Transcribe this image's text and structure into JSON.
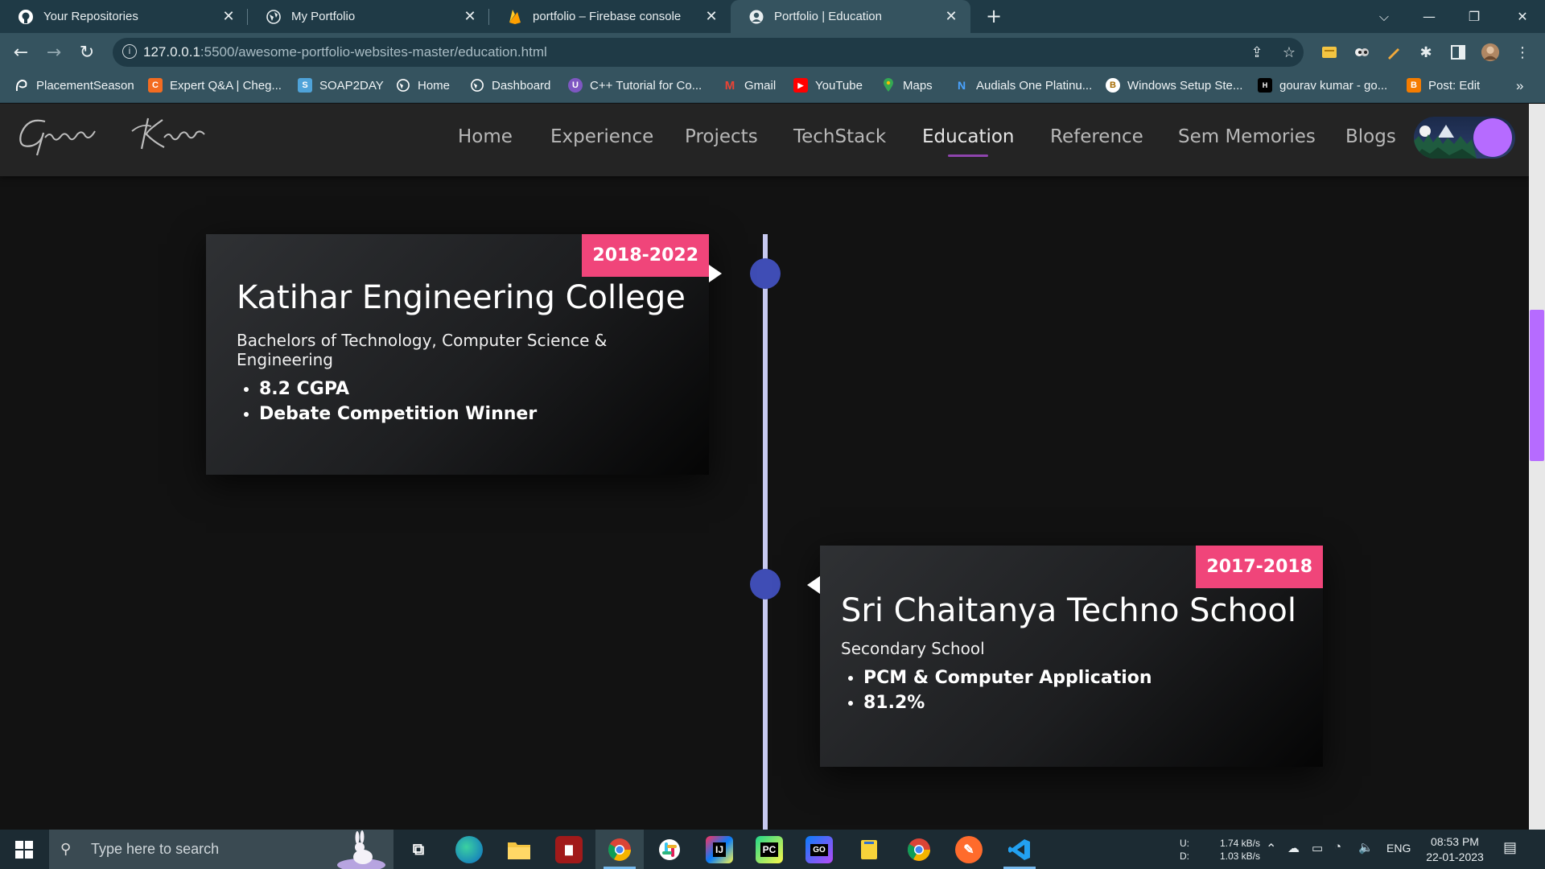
{
  "browser": {
    "tabs": [
      {
        "label": "Your Repositories",
        "icon": "github-icon"
      },
      {
        "label": "My Portfolio",
        "icon": "globe-icon"
      },
      {
        "label": "portfolio – Firebase console",
        "icon": "firebase-icon"
      },
      {
        "label": "Portfolio | Education",
        "icon": "avatar-icon",
        "active": true
      }
    ],
    "url_host": "127.0.0.1",
    "url_path": ":5500/awesome-portfolio-websites-master/education.html",
    "bookmarks": [
      {
        "label": "PlacementSeason",
        "icon": "placementseason-icon",
        "color": "#2e7d32"
      },
      {
        "label": "Expert Q&A | Cheg...",
        "icon": "chegg-icon",
        "color": "#f36c21",
        "glyph": "C"
      },
      {
        "label": "SOAP2DAY",
        "icon": "soap2day-icon",
        "color": "#4fa3d9",
        "glyph": "S"
      },
      {
        "label": "Home",
        "icon": "globe-icon",
        "color": "#607d8b"
      },
      {
        "label": "Dashboard",
        "icon": "globe-icon",
        "color": "#607d8b"
      },
      {
        "label": "C++ Tutorial for Co...",
        "icon": "cpp-icon",
        "color": "#7e57c2",
        "glyph": "U"
      },
      {
        "label": "Gmail",
        "icon": "gmail-icon",
        "color": "#ea4335",
        "glyph": "M"
      },
      {
        "label": "YouTube",
        "icon": "youtube-icon",
        "color": "#ff0000",
        "glyph": "▶"
      },
      {
        "label": "Maps",
        "icon": "maps-icon",
        "color": "#34a853",
        "glyph": "●"
      },
      {
        "label": "Audials One Platinu...",
        "icon": "audials-icon",
        "color": "#1565c0",
        "glyph": "N"
      },
      {
        "label": "Windows Setup Ste...",
        "icon": "windows-setup-icon",
        "color": "#f9a825",
        "glyph": "B"
      },
      {
        "label": "gourav kumar - go...",
        "icon": "hashnode-icon",
        "color": "#000000",
        "glyph": "H"
      },
      {
        "label": "Post: Edit",
        "icon": "blogger-icon",
        "color": "#f57c00",
        "glyph": "B"
      }
    ],
    "bookmarks_overflow": "»"
  },
  "site": {
    "logo_text": "Gourav Kumar",
    "nav": [
      {
        "label": "Home"
      },
      {
        "label": "Experience"
      },
      {
        "label": "Projects"
      },
      {
        "label": "TechStack"
      },
      {
        "label": "Education",
        "active": true
      },
      {
        "label": "Reference"
      },
      {
        "label": "Sem Memories"
      },
      {
        "label": "Blogs"
      }
    ]
  },
  "education": [
    {
      "years": "2018-2022",
      "institution": "Katihar Engineering College",
      "degree": "Bachelors of Technology, Computer Science & Engineering",
      "points": [
        "8.2 CGPA",
        "Debate Competition Winner"
      ]
    },
    {
      "years": "2017-2018",
      "institution": "Sri Chaitanya Techno School",
      "degree": "Secondary School",
      "points": [
        "PCM & Computer Application",
        "81.2%"
      ]
    }
  ],
  "colors": {
    "badge": "#f0457a",
    "timeline_dot": "#3f4db5",
    "accent": "#b66bff",
    "tabbar": "#1f3a46",
    "toolbar": "#35535f"
  },
  "taskbar": {
    "search_placeholder": "Type here to search",
    "net_up_label": "U:",
    "net_down_label": "D:",
    "net_up": "1.74 kB/s",
    "net_down": "1.03 kB/s",
    "language": "ENG",
    "time": "08:53 PM",
    "date": "22-01-2023"
  }
}
